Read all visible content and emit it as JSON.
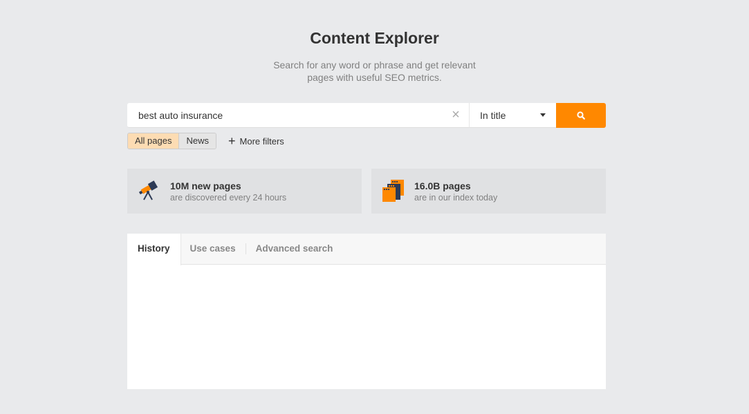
{
  "header": {
    "title": "Content Explorer",
    "subtitle_line1": "Search for any word or phrase and get relevant",
    "subtitle_line2": "pages with useful SEO metrics."
  },
  "search": {
    "value": "best auto insurance",
    "clear_icon": "close-icon",
    "mode": "In title",
    "button_icon": "search-icon",
    "accent_color": "#ff8800"
  },
  "filters": {
    "segments": [
      {
        "label": "All pages",
        "active": true
      },
      {
        "label": "News",
        "active": false
      }
    ],
    "more_filters": "More filters"
  },
  "stats": [
    {
      "icon": "telescope-icon",
      "title": "10M new pages",
      "subtitle": "are discovered every 24 hours"
    },
    {
      "icon": "pages-stack-icon",
      "title": "16.0B pages",
      "subtitle": "are in our index today"
    }
  ],
  "tabs": [
    {
      "label": "History",
      "active": true
    },
    {
      "label": "Use cases",
      "active": false
    },
    {
      "label": "Advanced search",
      "active": false
    }
  ]
}
